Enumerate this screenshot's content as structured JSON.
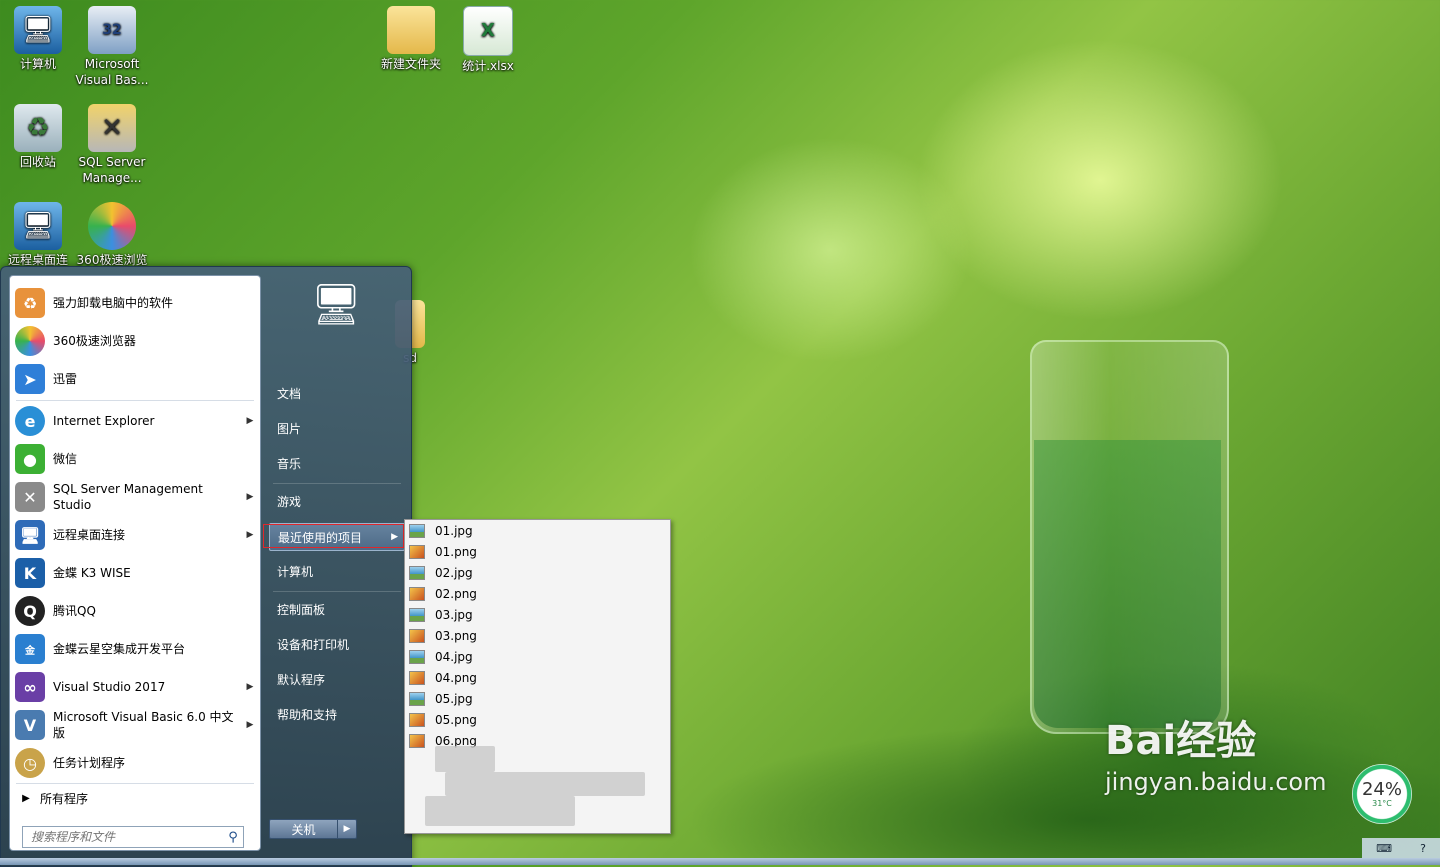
{
  "desktop": {
    "icons": [
      {
        "label": "计算机",
        "icon": "computer-icon"
      },
      {
        "label": "Microsoft Visual Bas...",
        "icon": "vb6-icon"
      },
      {
        "label": "回收站",
        "icon": "recycle-bin-icon"
      },
      {
        "label": "SQL Server Manage...",
        "icon": "sql-server-icon"
      },
      {
        "label": "远程桌面连",
        "icon": "remote-desktop-icon"
      },
      {
        "label": "360极速浏览",
        "icon": "browser-360-icon"
      },
      {
        "label": "新建文件夹",
        "icon": "folder-icon"
      },
      {
        "label": "统计.xlsx",
        "icon": "excel-icon"
      },
      {
        "label": "sd",
        "icon": "folder-icon"
      }
    ]
  },
  "start_menu": {
    "programs": [
      {
        "label": "强力卸载电脑中的软件",
        "icon": "uninstall-icon",
        "color": "#e8923b"
      },
      {
        "label": "360极速浏览器",
        "icon": "browser-360-icon",
        "color": "#e94b6a"
      },
      {
        "label": "迅雷",
        "icon": "xunlei-icon",
        "color": "#2f7fd8"
      },
      {
        "label": "Internet Explorer",
        "icon": "ie-icon",
        "color": "#2a8fd6"
      },
      {
        "label": "微信",
        "icon": "wechat-icon",
        "color": "#3cb034"
      },
      {
        "label": "SQL Server Management Studio",
        "icon": "sql-server-icon",
        "color": "#8a8a8a"
      },
      {
        "label": "远程桌面连接",
        "icon": "remote-desktop-icon",
        "color": "#2e6bb8"
      },
      {
        "label": "金蝶 K3 WISE",
        "icon": "kingdee-k3-icon",
        "color": "#1b5fa8"
      },
      {
        "label": "腾讯QQ",
        "icon": "qq-icon",
        "color": "#222222"
      },
      {
        "label": "金蝶云星空集成开发平台",
        "icon": "kingdee-cloud-icon",
        "color": "#2a7fd0"
      },
      {
        "label": "Visual Studio 2017",
        "icon": "visual-studio-icon",
        "color": "#6a3fa6"
      },
      {
        "label": "Microsoft Visual Basic 6.0 中文版",
        "icon": "vb6-icon",
        "color": "#4a7bb0"
      },
      {
        "label": "任务计划程序",
        "icon": "clock-icon",
        "color": "#c9a34a"
      }
    ],
    "all_programs": "所有程序",
    "search_placeholder": "搜索程序和文件",
    "right_items": {
      "documents": "文档",
      "pictures": "图片",
      "music": "音乐",
      "games": "游戏",
      "recent": "最近使用的项目",
      "computer": "计算机",
      "control_panel": "控制面板",
      "devices": "设备和打印机",
      "default_programs": "默认程序",
      "help": "帮助和支持"
    },
    "shutdown_label": "关机"
  },
  "recent_items": [
    {
      "name": "01.jpg",
      "type": "jpg"
    },
    {
      "name": "01.png",
      "type": "png"
    },
    {
      "name": "02.jpg",
      "type": "jpg"
    },
    {
      "name": "02.png",
      "type": "png"
    },
    {
      "name": "03.jpg",
      "type": "jpg"
    },
    {
      "name": "03.png",
      "type": "png"
    },
    {
      "name": "04.jpg",
      "type": "jpg"
    },
    {
      "name": "04.png",
      "type": "png"
    },
    {
      "name": "05.jpg",
      "type": "jpg"
    },
    {
      "name": "05.png",
      "type": "png"
    },
    {
      "name": "06.png",
      "type": "png"
    }
  ],
  "widgets": {
    "cpu_usage": "24%",
    "temperature": "31°C"
  },
  "watermark": {
    "brand": "Bai经验",
    "url": "jingyan.baidu.com"
  },
  "tray": {
    "help_glyph": "?"
  }
}
